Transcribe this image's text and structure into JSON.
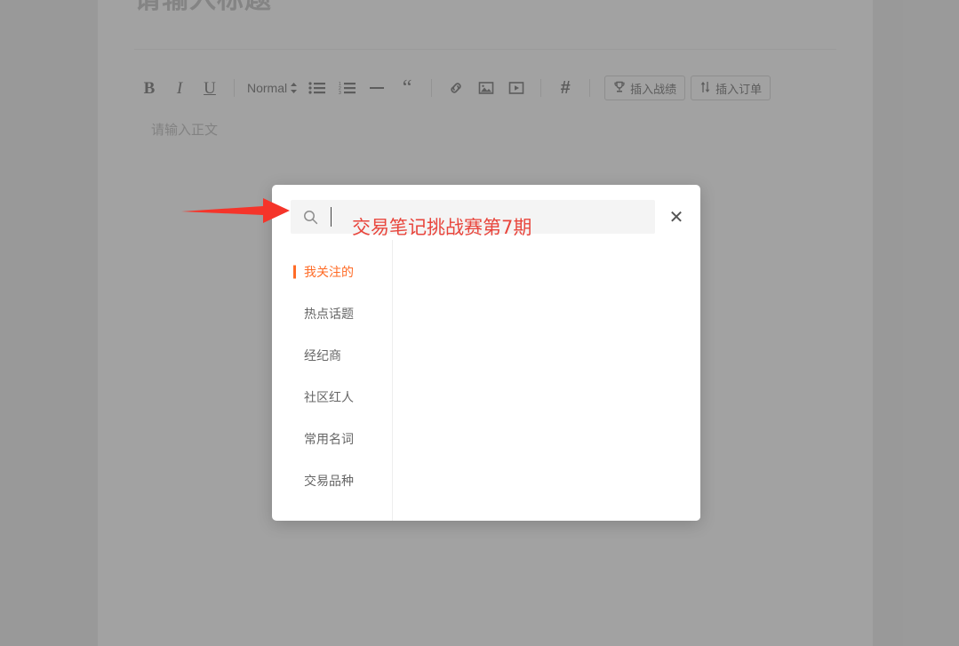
{
  "editor": {
    "title_placeholder": "请输入标题",
    "body_placeholder": "请输入正文",
    "toolbar": {
      "bold_label": "B",
      "italic_label": "I",
      "underline_label": "U",
      "format_label": "Normal",
      "bullet_list_name": "bullet-list-icon",
      "ordered_list_name": "ordered-list-icon",
      "divider_name": "horizontal-rule-icon",
      "quote_label": "“",
      "link_name": "link-icon",
      "image_name": "image-icon",
      "video_name": "video-icon",
      "hash_label": "#",
      "insert_record_label": "插入战绩",
      "insert_order_label": "插入订单"
    }
  },
  "modal": {
    "search": {
      "value": "",
      "placeholder": ""
    },
    "close_label": "✕",
    "sidebar_items": [
      {
        "label": "我关注的",
        "active": true
      },
      {
        "label": "热点话题",
        "active": false
      },
      {
        "label": "经纪商",
        "active": false
      },
      {
        "label": "社区红人",
        "active": false
      },
      {
        "label": "常用名词",
        "active": false
      },
      {
        "label": "交易品种",
        "active": false
      }
    ]
  },
  "annotation": {
    "note_text": "交易笔记挑战赛第7期",
    "arrow_color": "#f5342a",
    "note_color": "#e8453c"
  },
  "colors": {
    "accent_orange": "#ff6b26",
    "page_background": "#a8a8a8",
    "panel_background": "#b2b2b2",
    "modal_background": "#ffffff",
    "search_field_background": "#f4f4f4"
  }
}
